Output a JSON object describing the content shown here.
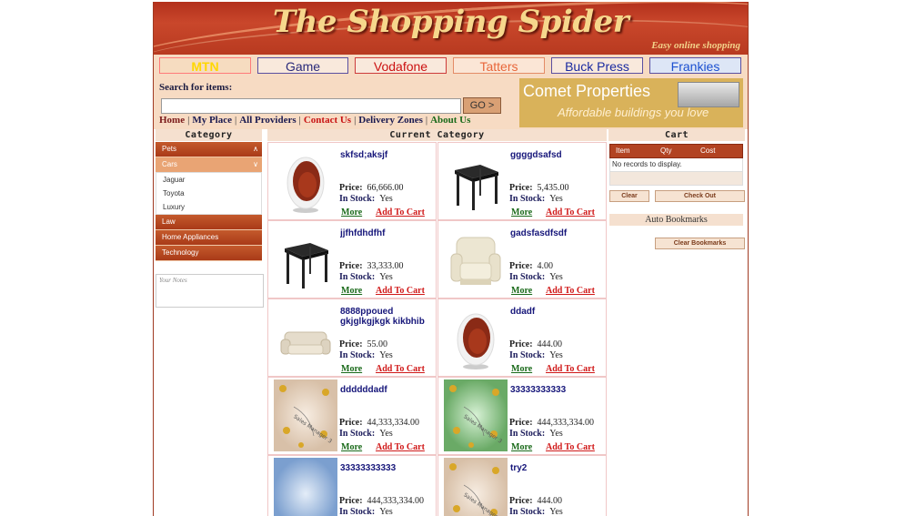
{
  "banner": {
    "title": "The Shopping Spider",
    "tagline": "Easy online shopping"
  },
  "providers": [
    "MTN",
    "Game",
    "Vodafone",
    "Tatters",
    "Buck Press",
    "Frankies"
  ],
  "search": {
    "label": "Search for items:",
    "value": "",
    "go_label": "GO >"
  },
  "nav": {
    "home": "Home",
    "my_place": "My Place",
    "all_providers": "All Providers",
    "contact": "Contact Us",
    "delivery": "Delivery Zones",
    "about": "About Us"
  },
  "ad": {
    "title": "Comet Properties",
    "subtitle": "Affordable buildings you love"
  },
  "sections": {
    "category": "Category",
    "current_category": "Current Category",
    "cart": "Cart"
  },
  "categories": {
    "pets": "Pets",
    "cars": "Cars",
    "car_models": [
      "Jaguar",
      "Toyota",
      "Luxury"
    ],
    "law": "Law",
    "home_appliances": "Home Appliances",
    "technology": "Technology"
  },
  "notes_placeholder": "Your Notes",
  "labels": {
    "price": "Price:",
    "in_stock": "In Stock:",
    "more": "More",
    "add_to_cart": "Add To Cart"
  },
  "products": [
    {
      "name": "skfsd;aksjf",
      "price": "66,666.00",
      "stock": "Yes",
      "icon": "egg-chair-image"
    },
    {
      "name": "ggggdsafsd",
      "price": "5,435.00",
      "stock": "Yes",
      "icon": "black-table-image"
    },
    {
      "name": "jjfhfdhdfhf",
      "price": "33,333.00",
      "stock": "Yes",
      "icon": "black-table-image"
    },
    {
      "name": "gadsfasdfsdf",
      "price": "4.00",
      "stock": "Yes",
      "icon": "armchair-image"
    },
    {
      "name": "8888ppoued gkjglkgjkgk kikbhib",
      "price": "55.00",
      "stock": "Yes",
      "icon": "sofa-image"
    },
    {
      "name": "ddadf",
      "price": "444.00",
      "stock": "Yes",
      "icon": "egg-chair-image"
    },
    {
      "name": "ddddddadf",
      "price": "44,333,334.00",
      "stock": "Yes",
      "icon": "sales-manager-image"
    },
    {
      "name": "33333333333",
      "price": "444,333,334.00",
      "stock": "Yes",
      "icon": "sales-manager-green-image"
    },
    {
      "name": "33333333333",
      "price": "444,333,334.00",
      "stock": "Yes",
      "icon": "blue-gradient-image"
    },
    {
      "name": "try2",
      "price": "444.00",
      "stock": "Yes",
      "icon": "sales-manager-image"
    }
  ],
  "cart": {
    "columns": [
      "Item",
      "Qty",
      "Cost"
    ],
    "empty_text": "No records to display.",
    "clear_label": "Clear",
    "checkout_label": "Check Out"
  },
  "bookmarks": {
    "title": "Auto Bookmarks",
    "clear_label": "Clear Bookmarks"
  },
  "colors": {
    "banner": "#b3301c",
    "accent": "#c45a2c",
    "price_link": "#d01818",
    "more_link": "#1a6a1a"
  }
}
